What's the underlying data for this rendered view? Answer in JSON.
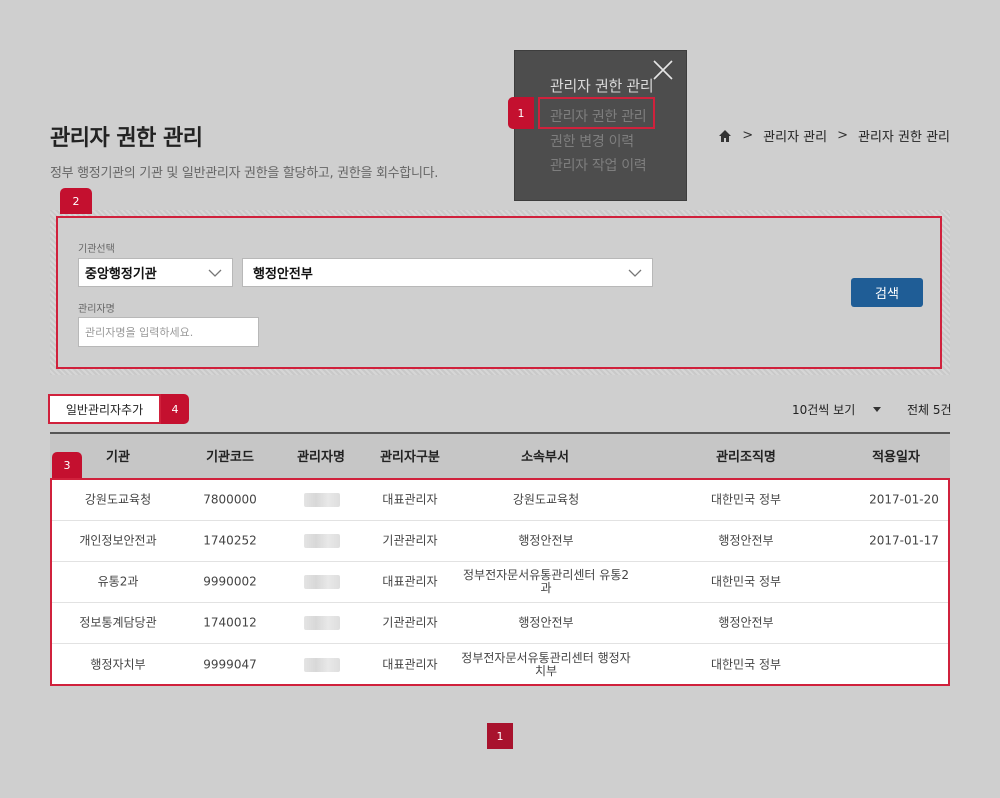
{
  "page": {
    "title": "관리자 권한 관리",
    "description": "정부 행정기관의 기관 및 일반관리자 권한을 할당하고, 권한을 회수합니다."
  },
  "breadcrumb": [
    "관리자 관리",
    "관리자 권한 관리"
  ],
  "menu": {
    "title": "관리자 권한 관리",
    "items": [
      "관리자 권한 관리",
      "권한 변경 이력",
      "관리자 작업 이력"
    ]
  },
  "badges": [
    "1",
    "2",
    "3",
    "4"
  ],
  "search": {
    "org_label": "기관선택",
    "org_value": "중앙행정기관",
    "dept_value": "행정안전부",
    "name_label": "관리자명",
    "name_placeholder": "관리자명을 입력하세요.",
    "button": "검색"
  },
  "toolbar": {
    "add_button": "일반관리자추가",
    "per_page": "10건씩 보기",
    "total": "전체 5건"
  },
  "table": {
    "headers": [
      "기관",
      "기관코드",
      "관리자명",
      "관리자구분",
      "소속부서",
      "관리조직명",
      "적용일자"
    ],
    "rows": [
      {
        "org": "강원도교육청",
        "code": "7800000",
        "type": "대표관리자",
        "dept": "강원도교육청",
        "unit": "대한민국 정부",
        "date": "2017-01-20"
      },
      {
        "org": "개인정보안전과",
        "code": "1740252",
        "type": "기관관리자",
        "dept": "행정안전부",
        "unit": "행정안전부",
        "date": "2017-01-17"
      },
      {
        "org": "유통2과",
        "code": "9990002",
        "type": "대표관리자",
        "dept": "정부전자문서유통관리센터 유통2과",
        "unit": "대한민국 정부",
        "date": ""
      },
      {
        "org": "정보통계담당관",
        "code": "1740012",
        "type": "기관관리자",
        "dept": "행정안전부",
        "unit": "행정안전부",
        "date": ""
      },
      {
        "org": "행정자치부",
        "code": "9999047",
        "type": "대표관리자",
        "dept": "정부전자문서유통관리센터 행정자치부",
        "unit": "대한민국 정부",
        "date": ""
      }
    ]
  },
  "pagination": {
    "current": "1"
  }
}
